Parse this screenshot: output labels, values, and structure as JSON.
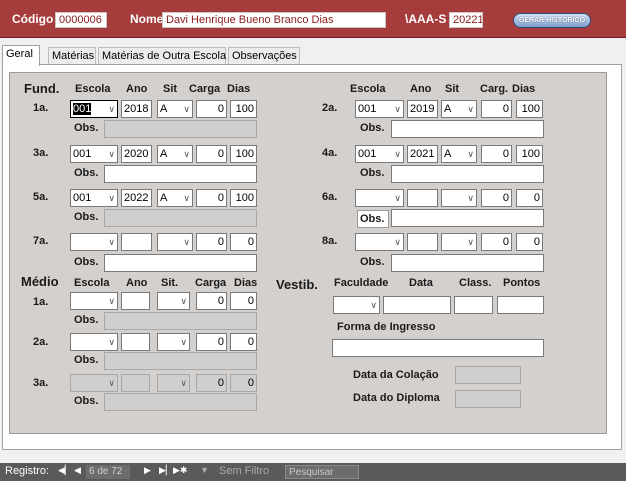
{
  "header": {
    "codigo_label": "Código",
    "codigo_value": "0000006",
    "nome_label": "Nome",
    "nome_value": "Davi Henrique Bueno Branco Dias",
    "aaaa_label": "\\AAA-S",
    "aaaa_value": "20221",
    "button_label": "GERAR HISTÓRICO"
  },
  "tabs": [
    "Geral",
    "Matérias",
    "Matérias de Outra Escola",
    "Observações"
  ],
  "fund": {
    "title": "Fund.",
    "headers": {
      "escola": "Escola",
      "ano": "Ano",
      "sit": "Sit",
      "carga": "Carga",
      "dias": "Dias",
      "carga_r": "Carg.",
      "dias_r": "Dias"
    },
    "obs_label": "Obs.",
    "rows": [
      {
        "label": "1a.",
        "escola": "001",
        "ano": "2018",
        "sit": "A",
        "carga": "0",
        "dias": "100"
      },
      {
        "label": "2a.",
        "escola": "001",
        "ano": "2019",
        "sit": "A",
        "carga": "0",
        "dias": "100"
      },
      {
        "label": "3a.",
        "escola": "001",
        "ano": "2020",
        "sit": "A",
        "carga": "0",
        "dias": "100"
      },
      {
        "label": "4a.",
        "escola": "001",
        "ano": "2021",
        "sit": "A",
        "carga": "0",
        "dias": "100"
      },
      {
        "label": "5a.",
        "escola": "001",
        "ano": "2022",
        "sit": "A",
        "carga": "0",
        "dias": "100"
      },
      {
        "label": "6a.",
        "escola": "",
        "ano": "",
        "sit": "",
        "carga": "0",
        "dias": "0"
      },
      {
        "label": "7a.",
        "escola": "",
        "ano": "",
        "sit": "",
        "carga": "0",
        "dias": "0"
      },
      {
        "label": "8a.",
        "escola": "",
        "ano": "",
        "sit": "",
        "carga": "0",
        "dias": "0"
      }
    ]
  },
  "medio": {
    "title": "Médio",
    "headers": {
      "escola": "Escola",
      "ano": "Ano",
      "sit": "Sit.",
      "carga": "Carga",
      "dias": "Dias"
    },
    "obs_label": "Obs.",
    "rows": [
      {
        "label": "1a.",
        "carga": "0",
        "dias": "0"
      },
      {
        "label": "2a.",
        "carga": "0",
        "dias": "0"
      },
      {
        "label": "3a.",
        "carga": "0",
        "dias": "0"
      }
    ]
  },
  "vestib": {
    "title": "Vestib.",
    "headers": {
      "faculdade": "Faculdade",
      "data": "Data",
      "class": "Class.",
      "pontos": "Pontos"
    },
    "forma_label": "Forma de Ingresso",
    "colacao_label": "Data da Colação",
    "diploma_label": "Data do Diploma"
  },
  "statusbar": {
    "registro_label": "Registro:",
    "record_value": "6 de 72",
    "filter_label": "Sem Filtro",
    "search_placeholder": "Pesquisar",
    "nav_icons": [
      "first-icon",
      "prev-icon",
      "next-icon",
      "last-icon",
      "new-record-icon"
    ]
  }
}
